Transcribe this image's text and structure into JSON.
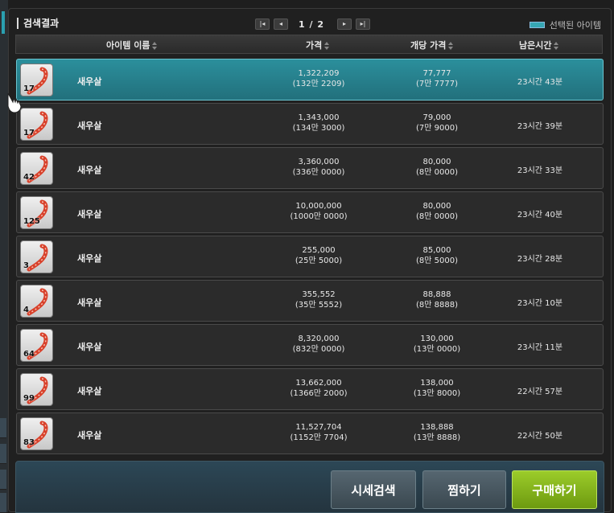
{
  "header": {
    "title": "검색결과",
    "page_info": "1 / 2",
    "legend_label": "선택된 아이템"
  },
  "columns": {
    "name": "아이템 이름",
    "price": "가격",
    "unit_price": "개당 가격",
    "time_left": "남은시간"
  },
  "rows": [
    {
      "qty": "17",
      "name": "새우살",
      "price": "1,322,209",
      "price_sub": "(132만 2209)",
      "unit": "77,777",
      "unit_sub": "(7만 7777)",
      "time": "23시간 43분",
      "selected": true
    },
    {
      "qty": "17",
      "name": "새우살",
      "price": "1,343,000",
      "price_sub": "(134만 3000)",
      "unit": "79,000",
      "unit_sub": "(7만 9000)",
      "time": "23시간 39분"
    },
    {
      "qty": "42",
      "name": "새우살",
      "price": "3,360,000",
      "price_sub": "(336만 0000)",
      "unit": "80,000",
      "unit_sub": "(8만 0000)",
      "time": "23시간 33분"
    },
    {
      "qty": "125",
      "name": "새우살",
      "price": "10,000,000",
      "price_sub": "(1000만 0000)",
      "unit": "80,000",
      "unit_sub": "(8만 0000)",
      "time": "23시간 40분"
    },
    {
      "qty": "3",
      "name": "새우살",
      "price": "255,000",
      "price_sub": "(25만 5000)",
      "unit": "85,000",
      "unit_sub": "(8만 5000)",
      "time": "23시간 28분"
    },
    {
      "qty": "4",
      "name": "새우살",
      "price": "355,552",
      "price_sub": "(35만 5552)",
      "unit": "88,888",
      "unit_sub": "(8만 8888)",
      "time": "23시간 10분"
    },
    {
      "qty": "64",
      "name": "새우살",
      "price": "8,320,000",
      "price_sub": "(832만 0000)",
      "unit": "130,000",
      "unit_sub": "(13만 0000)",
      "time": "23시간 11분"
    },
    {
      "qty": "99",
      "name": "새우살",
      "price": "13,662,000",
      "price_sub": "(1366만 2000)",
      "unit": "138,000",
      "unit_sub": "(13만 8000)",
      "time": "22시간 57분"
    },
    {
      "qty": "83",
      "name": "새우살",
      "price": "11,527,704",
      "price_sub": "(1152만 7704)",
      "unit": "138,888",
      "unit_sub": "(13만 8888)",
      "time": "22시간 50분"
    }
  ],
  "buttons": {
    "market_search": "시세검색",
    "wishlist": "찜하기",
    "buy": "구매하기"
  },
  "icons": {
    "item": "shrimp-icon",
    "pager_first": "first-page-icon",
    "pager_prev": "prev-page-icon",
    "pager_next": "next-page-icon",
    "pager_last": "last-page-icon",
    "cursor": "hand-cursor-icon"
  },
  "colors": {
    "accent": "#36a7b4",
    "selected_row": "#2b8f9c",
    "buy_button": "#8bbf1e"
  }
}
